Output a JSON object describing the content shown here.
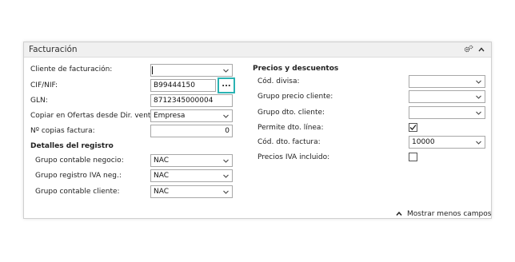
{
  "panel": {
    "title": "Facturación"
  },
  "left": {
    "billing_customer": {
      "label": "Cliente de facturación:",
      "value": ""
    },
    "vat_id": {
      "label": "CIF/NIF:",
      "value": "B99444150",
      "lookup": "..."
    },
    "gln": {
      "label": "GLN:",
      "value": "8712345000004"
    },
    "copy_offers": {
      "label": "Copiar en Ofertas desde Dir. venta:",
      "value": "Empresa"
    },
    "invoice_copies": {
      "label": "Nº copias factura:",
      "value": "0"
    },
    "section_title": "Detalles del registro",
    "gen_bus_posting": {
      "label": "Grupo contable negocio:",
      "value": "NAC"
    },
    "vat_bus_posting": {
      "label": "Grupo registro IVA neg.:",
      "value": "NAC"
    },
    "customer_posting": {
      "label": "Grupo contable cliente:",
      "value": "NAC"
    }
  },
  "right": {
    "section_title": "Precios y descuentos",
    "currency_code": {
      "label": "Cód. divisa:",
      "value": ""
    },
    "price_group": {
      "label": "Grupo precio cliente:",
      "value": ""
    },
    "disc_group": {
      "label": "Grupo dto. cliente:",
      "value": ""
    },
    "allow_line_disc": {
      "label": "Permite dto. línea:",
      "checked": true
    },
    "invoice_disc_code": {
      "label": "Cód. dto. factura:",
      "value": "10000"
    },
    "prices_incl_vat": {
      "label": "Precios IVA incluido:",
      "checked": false
    }
  },
  "footer": {
    "show_less": "Mostrar menos campos"
  },
  "icons": {
    "settings": "gears-icon",
    "collapse": "chevron-up-icon",
    "dropdown": "chevron-down-icon",
    "check": "check-icon"
  },
  "colors": {
    "lookup_border": "#2ab3b3",
    "header_bg": "#f0f0f0"
  }
}
